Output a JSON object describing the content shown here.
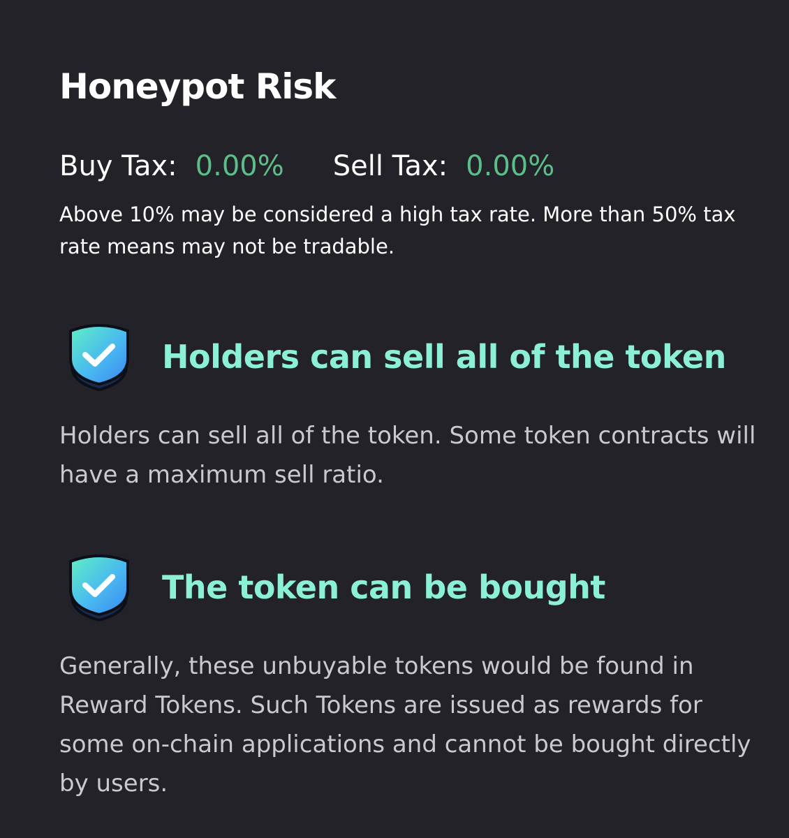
{
  "section": {
    "title": "Honeypot Risk"
  },
  "tax": {
    "buy_label": "Buy Tax:",
    "buy_value": "0.00%",
    "sell_label": "Sell Tax:",
    "sell_value": "0.00%",
    "value_color": "#5cbf8a",
    "note": "Above 10% may be considered a high tax rate. More than 50% tax rate means may not be tradable."
  },
  "checks": [
    {
      "icon": "shield-check-icon",
      "title": "Holders can sell all of the token",
      "description": "Holders can sell all of the token. Some token contracts will have a maximum sell ratio."
    },
    {
      "icon": "shield-check-icon",
      "title": "The token can be bought",
      "description": "Generally, these unbuyable tokens would be found in Reward Tokens. Such Tokens are issued as rewards for some on-chain applications and cannot be bought directly by users."
    }
  ],
  "colors": {
    "background": "#232228",
    "check_title": "#8cf0d6",
    "description": "#c9c9cf"
  }
}
